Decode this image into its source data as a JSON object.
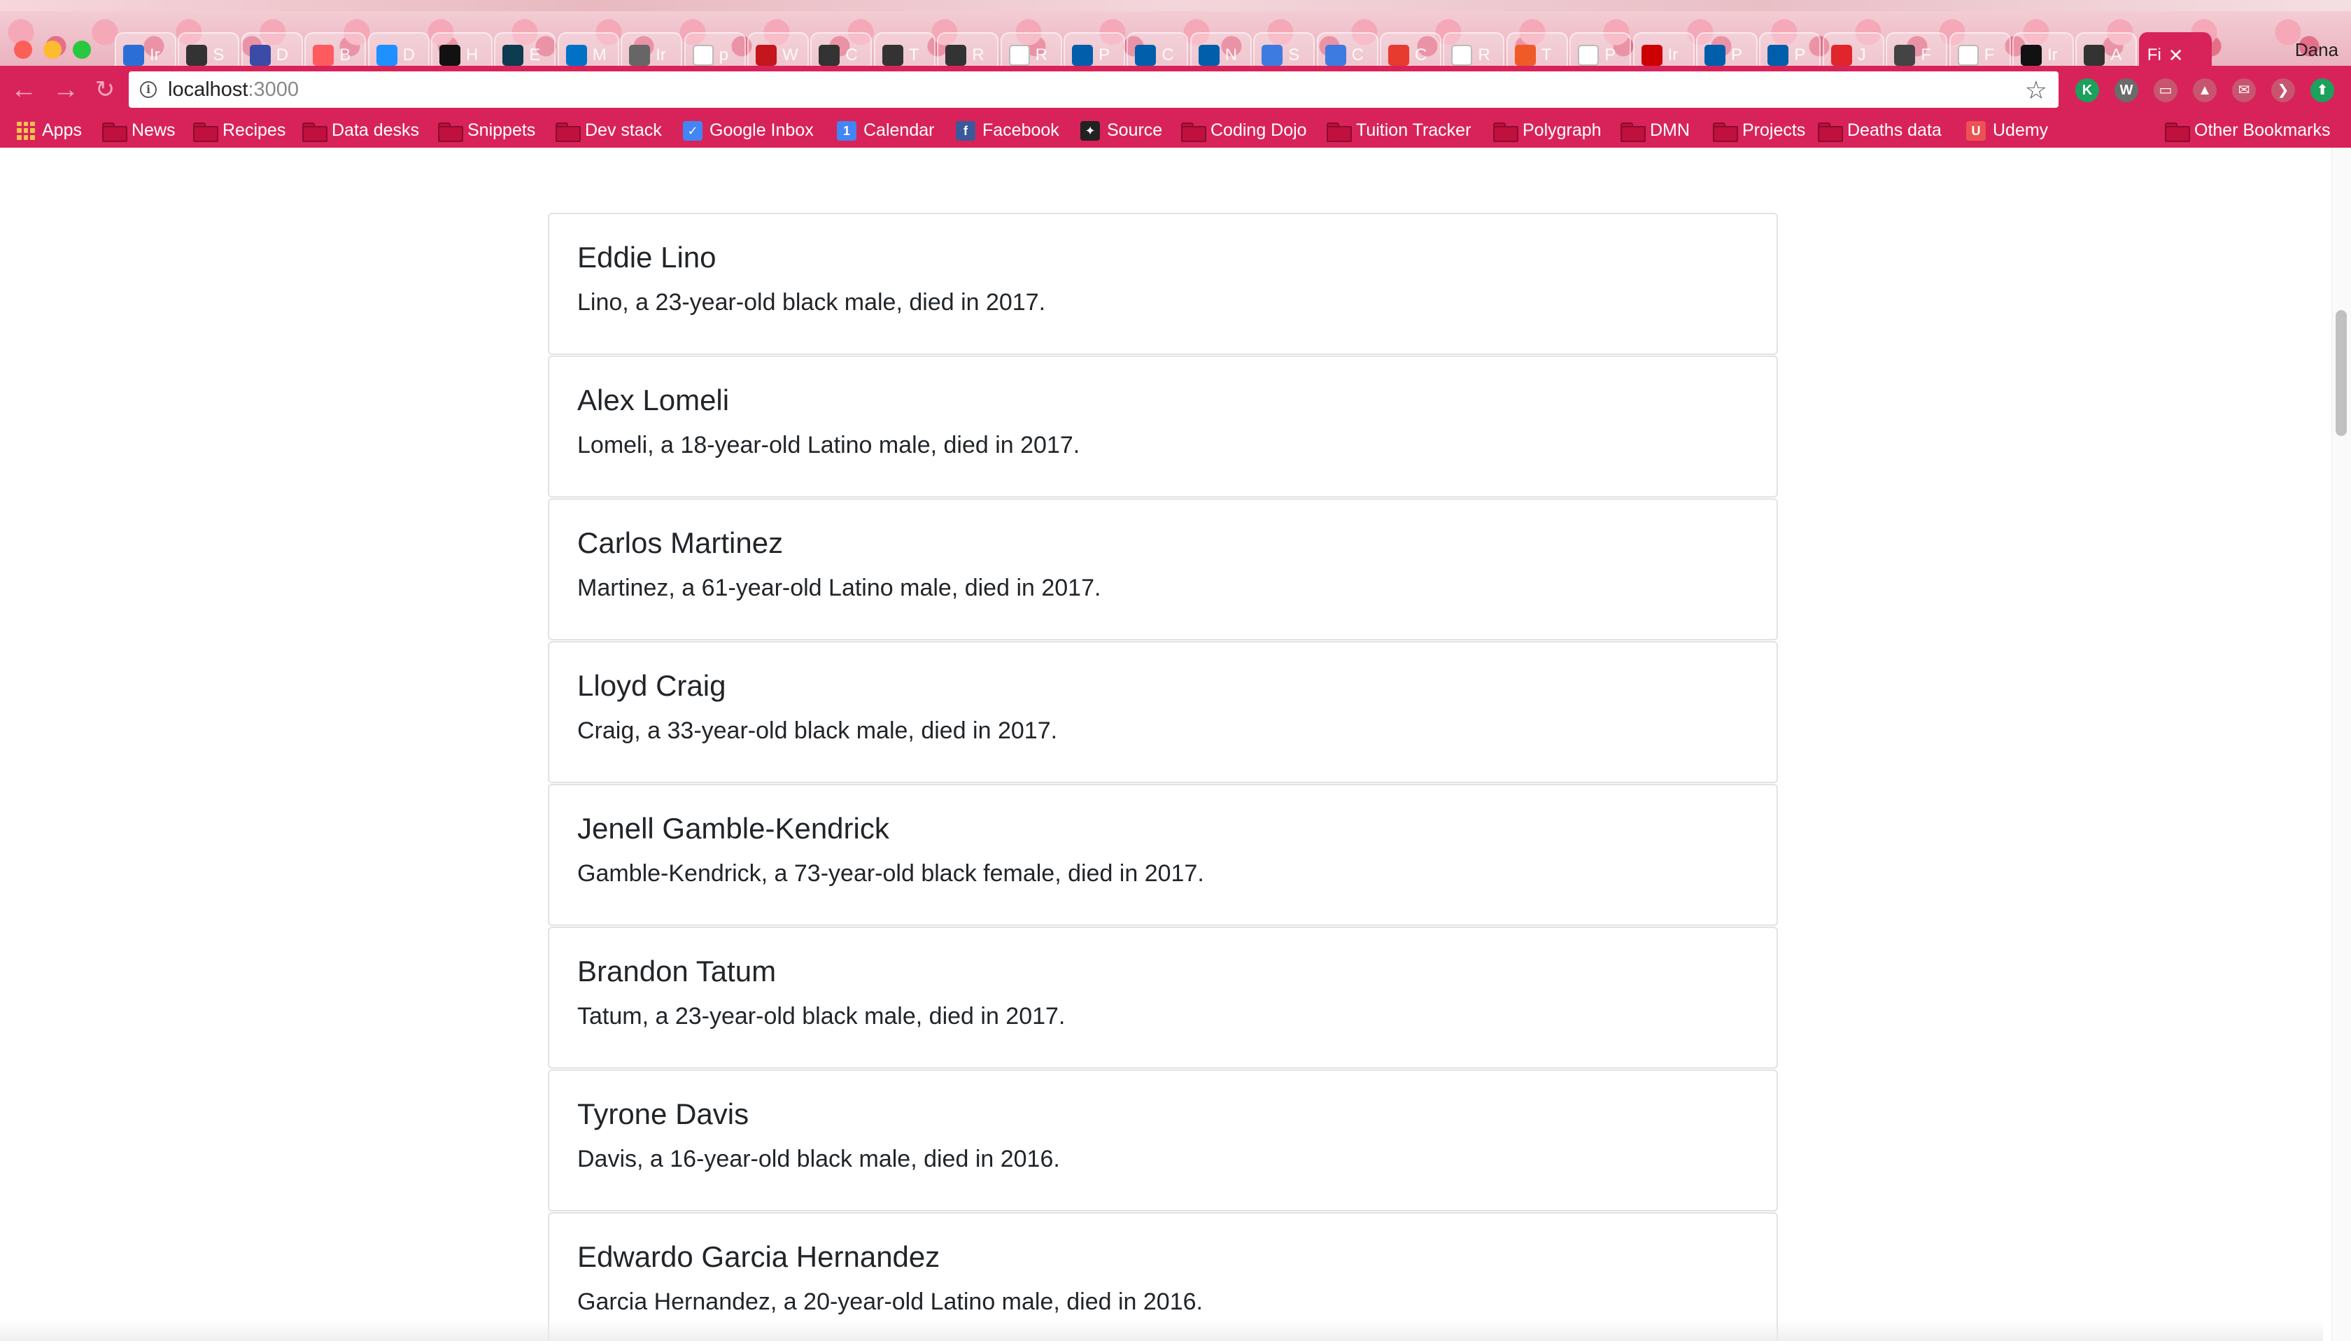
{
  "browser": {
    "profile_name": "Dana",
    "url_host": "localhost",
    "url_port": ":3000",
    "tabs": [
      {
        "favicon": "mail-icon",
        "color": "#2b6fd6",
        "title": "Ir"
      },
      {
        "favicon": "bar-chart-icon",
        "color": "#333333",
        "title": "S"
      },
      {
        "favicon": "chart-icon",
        "color": "#3a4ca8",
        "title": "D"
      },
      {
        "favicon": "airbnb-icon",
        "color": "#ff5a5f",
        "title": "B"
      },
      {
        "favicon": "d-icon",
        "color": "#1e90ff",
        "title": "D"
      },
      {
        "favicon": "nyt-icon",
        "color": "#111111",
        "title": "H"
      },
      {
        "favicon": "cp-icon",
        "color": "#0d3b4f",
        "title": "E"
      },
      {
        "favicon": "outlook-icon",
        "color": "#0072c6",
        "title": "M"
      },
      {
        "favicon": "scatter-icon",
        "color": "#666666",
        "title": "Ir"
      },
      {
        "favicon": "doc-icon",
        "color": "#ffffff",
        "title": "p"
      },
      {
        "favicon": "n-icon",
        "color": "#c4161c",
        "title": "W"
      },
      {
        "favicon": "s-icon",
        "color": "#333333",
        "title": "C"
      },
      {
        "favicon": "s-icon",
        "color": "#333333",
        "title": "T"
      },
      {
        "favicon": "s-icon",
        "color": "#333333",
        "title": "R"
      },
      {
        "favicon": "doc-icon",
        "color": "#ffffff",
        "title": "R"
      },
      {
        "favicon": "cdc-icon",
        "color": "#005eaa",
        "title": "P"
      },
      {
        "favicon": "cdc-icon",
        "color": "#005eaa",
        "title": "C"
      },
      {
        "favicon": "cdc-icon",
        "color": "#005eaa",
        "title": "N"
      },
      {
        "favicon": "grid-icon",
        "color": "#3d7be0",
        "title": "S"
      },
      {
        "favicon": "grid-icon",
        "color": "#3d7be0",
        "title": "C"
      },
      {
        "favicon": "t-icon",
        "color": "#e63b2e",
        "title": "C"
      },
      {
        "favicon": "doc-icon",
        "color": "#ffffff",
        "title": "R"
      },
      {
        "favicon": "bt-icon",
        "color": "#f05a28",
        "title": "T"
      },
      {
        "favicon": "doc-icon",
        "color": "#ffffff",
        "title": "P"
      },
      {
        "favicon": "cnn-icon",
        "color": "#cc0000",
        "title": "Ir"
      },
      {
        "favicon": "cdc-icon",
        "color": "#005eaa",
        "title": "P"
      },
      {
        "favicon": "cdc-icon",
        "color": "#005eaa",
        "title": "P"
      },
      {
        "favicon": "di-icon",
        "color": "#e0262a",
        "title": "J"
      },
      {
        "favicon": "book-icon",
        "color": "#444444",
        "title": "F"
      },
      {
        "favicon": "doc-icon",
        "color": "#ffffff",
        "title": "F"
      },
      {
        "favicon": "github-icon",
        "color": "#111111",
        "title": "Ir"
      },
      {
        "favicon": "bar-chart-icon",
        "color": "#333333",
        "title": "A"
      }
    ],
    "active_tab_title": "Fi",
    "extensions": [
      {
        "name": "k-extension-icon",
        "glyph": "K",
        "color": "#1aa15b"
      },
      {
        "name": "w-extension-icon",
        "glyph": "W",
        "color": "#6b6b6b"
      },
      {
        "name": "cast-icon",
        "glyph": "▭",
        "color": "#c8556f"
      },
      {
        "name": "drive-icon",
        "glyph": "▲",
        "color": "#c8556f"
      },
      {
        "name": "inbox-icon",
        "glyph": "✉",
        "color": "#c8556f"
      },
      {
        "name": "pocket-icon",
        "glyph": "❯",
        "color": "#c8556f"
      },
      {
        "name": "update-icon",
        "glyph": "⬆",
        "color": "#1aa15b"
      }
    ]
  },
  "bookmarks": [
    {
      "label": "Apps",
      "type": "apps"
    },
    {
      "label": "News",
      "type": "folder"
    },
    {
      "label": "Recipes",
      "type": "folder"
    },
    {
      "label": "Data desks",
      "type": "folder"
    },
    {
      "label": "Snippets",
      "type": "folder"
    },
    {
      "label": "Dev stack",
      "type": "folder"
    },
    {
      "label": "Google Inbox",
      "type": "icon",
      "glyph": "✓",
      "color": "#4285f4"
    },
    {
      "label": "Calendar",
      "type": "icon",
      "glyph": "1",
      "color": "#4285f4"
    },
    {
      "label": "Facebook",
      "type": "icon",
      "glyph": "f",
      "color": "#3b5998"
    },
    {
      "label": "Source",
      "type": "icon",
      "glyph": "✦",
      "color": "#222222"
    },
    {
      "label": "Coding Dojo",
      "type": "folder"
    },
    {
      "label": "Tuition Tracker",
      "type": "folder"
    },
    {
      "label": "Polygraph",
      "type": "folder"
    },
    {
      "label": "DMN",
      "type": "folder"
    },
    {
      "label": "Projects",
      "type": "folder"
    },
    {
      "label": "Deaths data",
      "type": "folder"
    },
    {
      "label": "Udemy",
      "type": "icon",
      "glyph": "U",
      "color": "#ec5252"
    }
  ],
  "other_bookmarks": "Other Bookmarks",
  "people": [
    {
      "name": "Eddie Lino",
      "description": "Lino, a 23-year-old black male, died in 2017."
    },
    {
      "name": "Alex Lomeli",
      "description": "Lomeli, a 18-year-old Latino male, died in 2017."
    },
    {
      "name": "Carlos Martinez",
      "description": "Martinez, a 61-year-old Latino male, died in 2017."
    },
    {
      "name": "Lloyd Craig",
      "description": "Craig, a 33-year-old black male, died in 2017."
    },
    {
      "name": "Jenell Gamble-Kendrick",
      "description": "Gamble-Kendrick, a 73-year-old black female, died in 2017."
    },
    {
      "name": "Brandon Tatum",
      "description": "Tatum, a 23-year-old black male, died in 2017."
    },
    {
      "name": "Tyrone Davis",
      "description": "Davis, a 16-year-old black male, died in 2016."
    },
    {
      "name": "Edwardo Garcia Hernandez",
      "description": "Garcia Hernandez, a 20-year-old Latino male, died in 2016."
    }
  ]
}
